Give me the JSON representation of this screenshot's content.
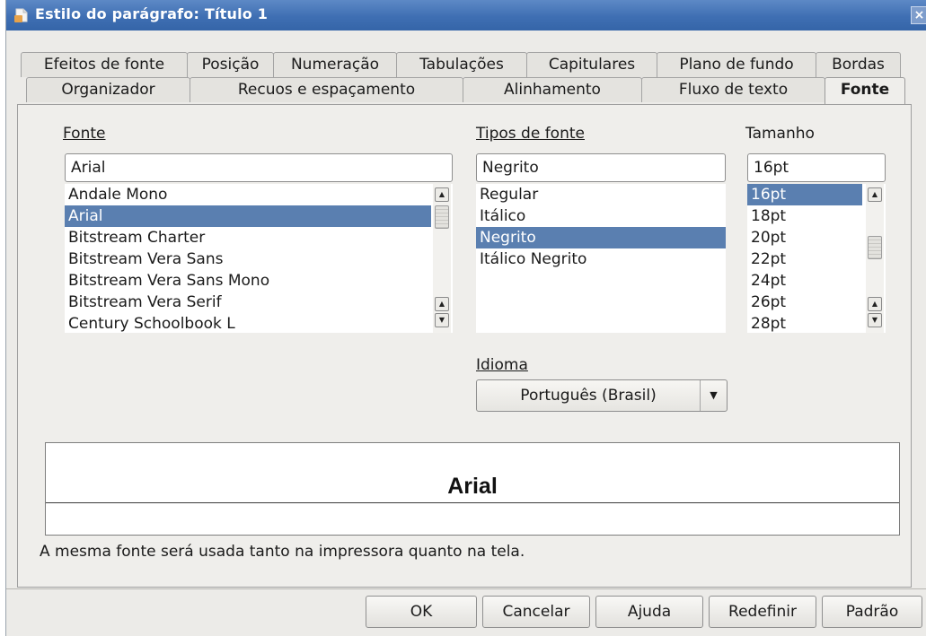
{
  "window": {
    "title": "Estilo do parágrafo: Título 1",
    "close_glyph": "×"
  },
  "tabs": {
    "row1": [
      "Efeitos de fonte",
      "Posição",
      "Numeração",
      "Tabulações",
      "Capitulares",
      "Plano de fundo",
      "Bordas"
    ],
    "row2": [
      "Organizador",
      "Recuos e espaçamento",
      "Alinhamento",
      "Fluxo de texto",
      "Fonte"
    ],
    "active": "Fonte"
  },
  "font": {
    "label": "Fonte",
    "value": "Arial",
    "options": [
      "Andale Mono",
      "Arial",
      "Bitstream Charter",
      "Bitstream Vera Sans",
      "Bitstream Vera Sans Mono",
      "Bitstream Vera Serif",
      "Century Schoolbook L"
    ],
    "selected": "Arial"
  },
  "style": {
    "label": "Tipos de fonte",
    "value": "Negrito",
    "options": [
      "Regular",
      "Itálico",
      "Negrito",
      "Itálico Negrito"
    ],
    "selected": "Negrito"
  },
  "size": {
    "label": "Tamanho",
    "value": "16pt",
    "options": [
      "16pt",
      "18pt",
      "20pt",
      "22pt",
      "24pt",
      "26pt",
      "28pt"
    ],
    "selected": "16pt"
  },
  "language": {
    "label": "Idioma",
    "value": "Português (Brasil)"
  },
  "preview": {
    "text": "Arial"
  },
  "note": "A mesma fonte será usada tanto na impressora quanto na tela.",
  "buttons": {
    "ok": "OK",
    "cancel": "Cancelar",
    "help": "Ajuda",
    "reset": "Redefinir",
    "default": "Padrão"
  },
  "colors": {
    "titlebar": "#3f6fb3",
    "selection": "#5a7fb0",
    "dialog_bg": "#ecebe8"
  },
  "icons": {
    "window": "document-icon",
    "close": "close-icon",
    "scroll_up": "arrow-up-icon",
    "scroll_down": "arrow-down-icon",
    "dropdown": "chevron-down-icon"
  }
}
